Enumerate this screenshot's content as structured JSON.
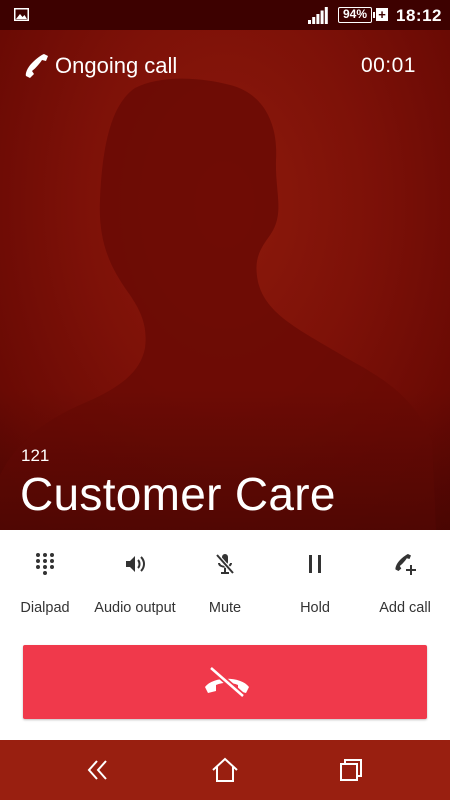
{
  "status_bar": {
    "notification_icon": "picture-icon",
    "signal_icon": "signal-icon",
    "battery": "94%",
    "charging_icon": "plus-icon",
    "time": "18:12"
  },
  "call": {
    "state_icon": "phone-icon",
    "state": "Ongoing call",
    "timer": "00:01",
    "number": "121",
    "name": "Customer Care"
  },
  "actions": [
    {
      "label": "Dialpad",
      "icon": "dialpad-icon"
    },
    {
      "label": "Audio output",
      "icon": "speaker-icon"
    },
    {
      "label": "Mute",
      "icon": "mic-off-icon"
    },
    {
      "label": "Hold",
      "icon": "pause-icon"
    },
    {
      "label": "Add call",
      "icon": "add-call-icon"
    }
  ],
  "end_call": {
    "icon": "end-call-icon",
    "color": "#f0394b"
  },
  "navigation": {
    "back_icon": "back-icon",
    "home_icon": "home-icon",
    "recents_icon": "recents-icon",
    "color": "#991f10"
  },
  "colors": {
    "hero_background": "#7d1108",
    "status_bar": "#3d0100"
  }
}
